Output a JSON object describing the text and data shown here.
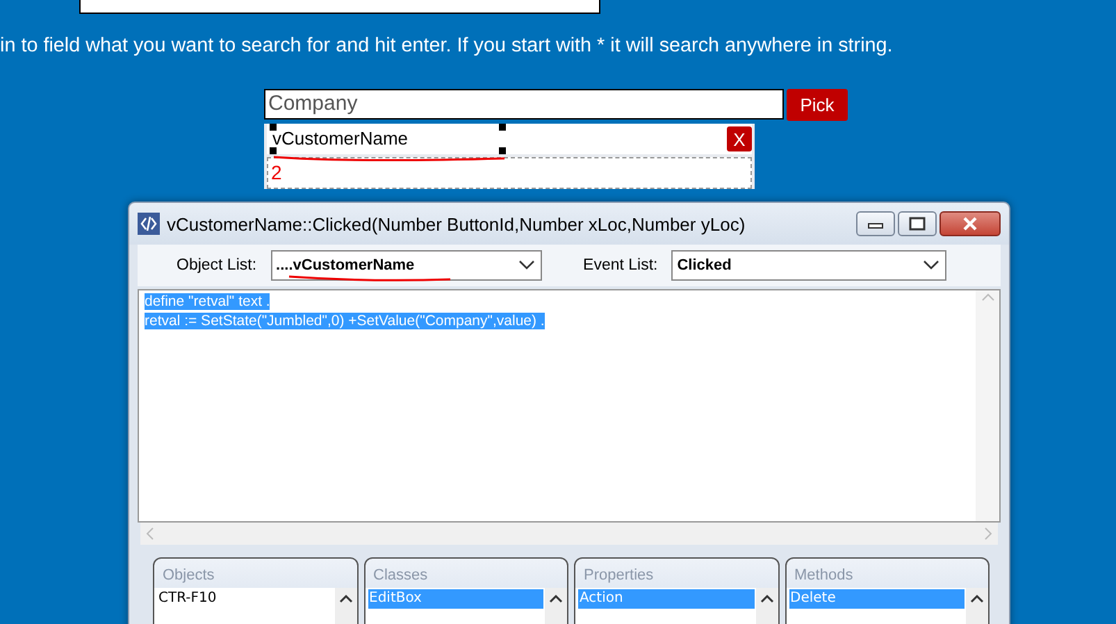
{
  "instruction": "in to field what you want to search for and hit enter. If you start with * it will search anywhere in string.",
  "search": {
    "value": "Company",
    "button": "Pick"
  },
  "design_control": {
    "label": "vCustomerName",
    "close": "X",
    "selected": true,
    "annotation": "2"
  },
  "dialog": {
    "title": "vCustomerName::Clicked(Number ButtonId,Number xLoc,Number yLoc)",
    "object_list": {
      "label": "Object List:",
      "value": "....vCustomerName"
    },
    "event_list": {
      "label": "Event List:",
      "value": "Clicked"
    },
    "code_lines": [
      {
        "text": "define \"retval\" text .",
        "selected": true
      },
      {
        "text": "retval := SetState(\"Jumbled\",0) +SetValue(\"Company\",value) .",
        "selected": true
      }
    ],
    "panels": [
      {
        "title": "Objects",
        "items": [
          {
            "label": "CTR-F10",
            "selected": false
          }
        ]
      },
      {
        "title": "Classes",
        "items": [
          {
            "label": "EditBox",
            "selected": true
          }
        ]
      },
      {
        "title": "Properties",
        "items": [
          {
            "label": "Action",
            "selected": true
          }
        ]
      },
      {
        "title": "Methods",
        "items": [
          {
            "label": "Delete",
            "selected": true
          }
        ]
      }
    ]
  }
}
